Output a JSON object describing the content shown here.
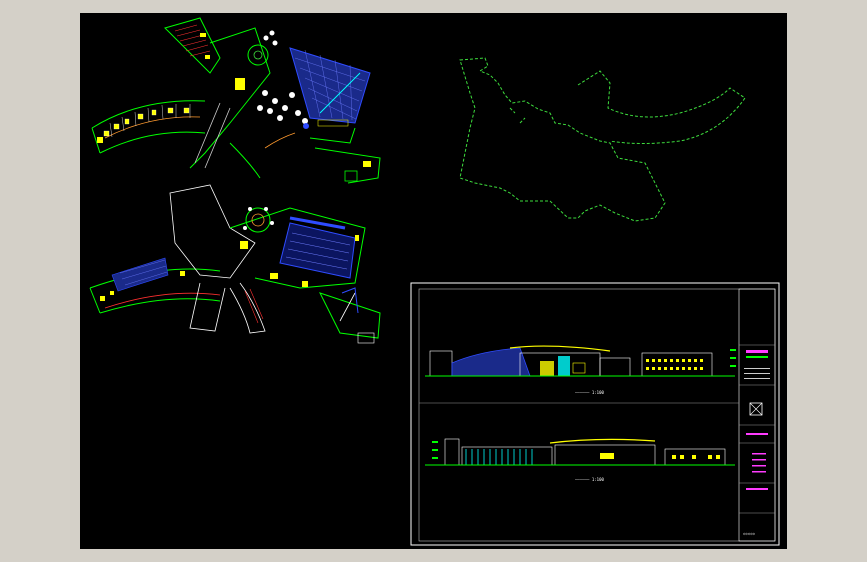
{
  "viewport": {
    "background": "#000000",
    "frame_color": "#d4d0c8"
  },
  "colors": {
    "green": "#00ff00",
    "dashed_outline": "#3ddc3d",
    "yellow": "#ffff00",
    "blue": "#2f4cff",
    "cyan": "#00ffff",
    "red": "#ff3030",
    "magenta": "#ff3cff",
    "white": "#ffffff",
    "orange": "#ff9a2e"
  },
  "drawings": {
    "plan_upper": "floor-plan-upper",
    "plan_lower": "floor-plan-lower",
    "site_outline": "dashed-site-outline",
    "sheet": "elevation-drawing-sheet"
  },
  "sheet": {
    "caption_top": "—————— 1:100",
    "caption_bottom": "—————— 1:100",
    "title_block_text": "◇◇◇◇◇"
  }
}
